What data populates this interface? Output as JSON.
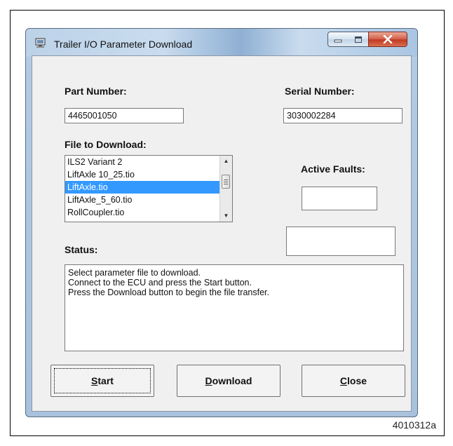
{
  "window": {
    "title": "Trailer I/O Parameter Download",
    "controls": {
      "minimize": "minimize-icon",
      "maximize": "maximize-icon",
      "close": "close-icon"
    }
  },
  "form": {
    "part_number_label": "Part Number:",
    "part_number_value": "4465001050",
    "serial_number_label": "Serial Number:",
    "serial_number_value": "3030002284",
    "file_label": "File to Download:",
    "files": [
      "ILS2 Variant 2",
      "LiftAxle 10_25.tio",
      "LiftAxle.tio",
      "LiftAxle_5_60.tio",
      "RollCoupler.tio"
    ],
    "selected_file": "LiftAxle.tio",
    "active_faults_label": "Active Faults:",
    "active_faults_value": "",
    "extra_value": "",
    "status_label": "Status:",
    "status_lines": [
      "Select parameter file to download.",
      "Connect to the ECU and press the Start button.",
      "Press the Download button to begin the file transfer."
    ]
  },
  "buttons": {
    "start": {
      "mnemonic": "S",
      "rest": "tart"
    },
    "download": {
      "mnemonic": "D",
      "rest": "ownload"
    },
    "close": {
      "mnemonic": "C",
      "rest": "lose"
    }
  },
  "figure_id": "4010312a"
}
